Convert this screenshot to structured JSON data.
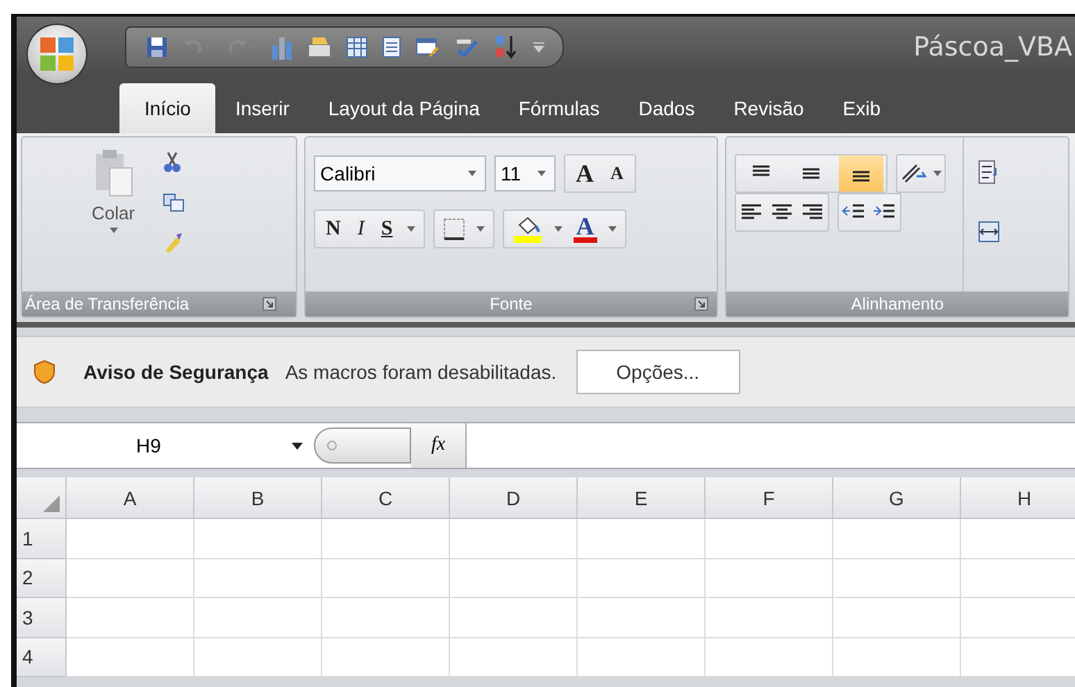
{
  "window": {
    "title": "Páscoa_VBA"
  },
  "quick_access": [
    {
      "kind": "save",
      "disabled": false
    },
    {
      "kind": "undo",
      "disabled": true
    },
    {
      "kind": "redo",
      "disabled": true
    },
    {
      "kind": "chart",
      "disabled": false
    },
    {
      "kind": "form",
      "disabled": false
    },
    {
      "kind": "table",
      "disabled": false
    },
    {
      "kind": "sheet",
      "disabled": false
    },
    {
      "kind": "grid",
      "disabled": false
    },
    {
      "kind": "spell",
      "disabled": false
    },
    {
      "kind": "sort",
      "disabled": false
    },
    {
      "kind": "more",
      "disabled": false
    }
  ],
  "tabs": [
    {
      "label": "Início",
      "selected": true
    },
    {
      "label": "Inserir",
      "selected": false
    },
    {
      "label": "Layout da Página",
      "selected": false
    },
    {
      "label": "Fórmulas",
      "selected": false
    },
    {
      "label": "Dados",
      "selected": false
    },
    {
      "label": "Revisão",
      "selected": false
    },
    {
      "label": "Exib",
      "selected": false
    }
  ],
  "clipboard": {
    "label": "Área de Transferência",
    "paste": "Colar"
  },
  "font": {
    "label": "Fonte",
    "name": "Calibri",
    "size": "11",
    "grow": "A",
    "shrink": "A",
    "bold": "N",
    "italic": "I",
    "underline": "S",
    "color_label": "A"
  },
  "alignment": {
    "label": "Alinhamento",
    "vertical": [
      {
        "selected": false
      },
      {
        "selected": false
      },
      {
        "selected": true
      }
    ]
  },
  "security_bar": {
    "title": "Aviso de Segurança",
    "message": "As macros foram desabilitadas.",
    "button": "Opções..."
  },
  "formula_bar": {
    "name_box": "H9",
    "function_label": "fx"
  },
  "sheet": {
    "columns": [
      "A",
      "B",
      "C",
      "D",
      "E",
      "F",
      "G",
      "H"
    ],
    "rows": [
      "1",
      "2",
      "3",
      "4"
    ]
  }
}
